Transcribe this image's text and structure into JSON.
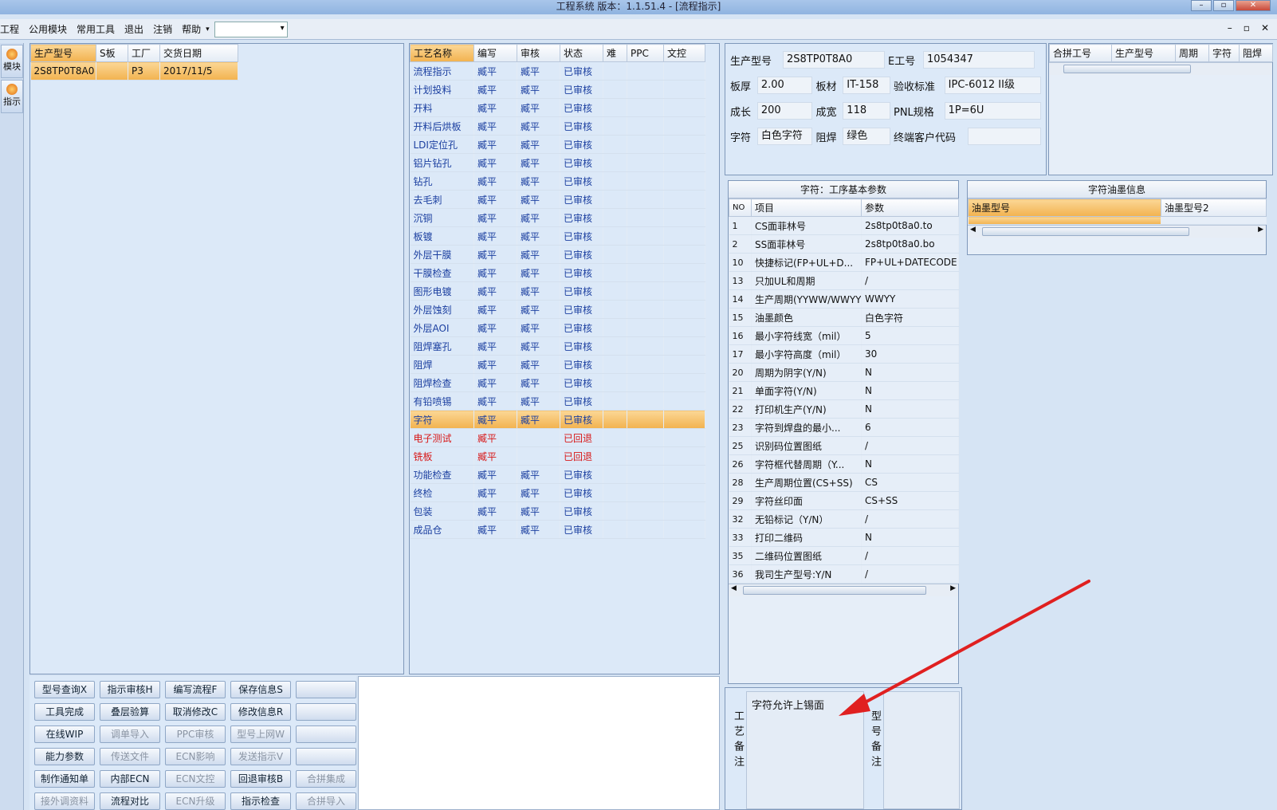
{
  "window": {
    "title": "工程系统   版本：1.1.51.4 - [流程指示]",
    "btn_min": "–",
    "btn_max": "▫",
    "btn_close": "✕"
  },
  "menu": {
    "items": [
      "工程",
      "公用模块",
      "常用工具",
      "退出",
      "注销",
      "帮助"
    ],
    "mdi": [
      "–",
      "▫",
      "✕"
    ]
  },
  "sidebar": {
    "items": [
      "模块",
      "指示"
    ]
  },
  "orders": {
    "headers": [
      "生产型号",
      "S板",
      "工厂",
      "交货日期"
    ],
    "rows": [
      [
        "2S8TP0T8A0",
        "",
        "P3",
        "2017/11/5"
      ]
    ]
  },
  "process": {
    "headers": [
      "工艺名称",
      "编写",
      "审核",
      "状态",
      "难",
      "PPC",
      "文控"
    ],
    "rows": [
      {
        "name": "流程指示",
        "writer": "臧平",
        "auditor": "臧平",
        "status": "已审核",
        "style": "blue"
      },
      {
        "name": "计划投料",
        "writer": "臧平",
        "auditor": "臧平",
        "status": "已审核",
        "style": "blue"
      },
      {
        "name": "开料",
        "writer": "臧平",
        "auditor": "臧平",
        "status": "已审核",
        "style": "blue"
      },
      {
        "name": "开料后烘板",
        "writer": "臧平",
        "auditor": "臧平",
        "status": "已审核",
        "style": "blue"
      },
      {
        "name": "LDI定位孔",
        "writer": "臧平",
        "auditor": "臧平",
        "status": "已审核",
        "style": "blue"
      },
      {
        "name": "铝片钻孔",
        "writer": "臧平",
        "auditor": "臧平",
        "status": "已审核",
        "style": "blue"
      },
      {
        "name": "钻孔",
        "writer": "臧平",
        "auditor": "臧平",
        "status": "已审核",
        "style": "blue"
      },
      {
        "name": "去毛刺",
        "writer": "臧平",
        "auditor": "臧平",
        "status": "已审核",
        "style": "blue"
      },
      {
        "name": "沉铜",
        "writer": "臧平",
        "auditor": "臧平",
        "status": "已审核",
        "style": "blue"
      },
      {
        "name": "板镀",
        "writer": "臧平",
        "auditor": "臧平",
        "status": "已审核",
        "style": "blue"
      },
      {
        "name": "外层干膜",
        "writer": "臧平",
        "auditor": "臧平",
        "status": "已审核",
        "style": "blue"
      },
      {
        "name": "干膜检查",
        "writer": "臧平",
        "auditor": "臧平",
        "status": "已审核",
        "style": "blue"
      },
      {
        "name": "图形电镀",
        "writer": "臧平",
        "auditor": "臧平",
        "status": "已审核",
        "style": "blue"
      },
      {
        "name": "外层蚀刻",
        "writer": "臧平",
        "auditor": "臧平",
        "status": "已审核",
        "style": "blue"
      },
      {
        "name": "外层AOI",
        "writer": "臧平",
        "auditor": "臧平",
        "status": "已审核",
        "style": "blue"
      },
      {
        "name": "阻焊塞孔",
        "writer": "臧平",
        "auditor": "臧平",
        "status": "已审核",
        "style": "blue"
      },
      {
        "name": "阻焊",
        "writer": "臧平",
        "auditor": "臧平",
        "status": "已审核",
        "style": "blue"
      },
      {
        "name": "阻焊检查",
        "writer": "臧平",
        "auditor": "臧平",
        "status": "已审核",
        "style": "blue"
      },
      {
        "name": "有铅喷锡",
        "writer": "臧平",
        "auditor": "臧平",
        "status": "已审核",
        "style": "blue"
      },
      {
        "name": "字符",
        "writer": "臧平",
        "auditor": "臧平",
        "status": "已审核",
        "style": "sel"
      },
      {
        "name": "电子测试",
        "writer": "臧平",
        "auditor": "",
        "status": "已回退",
        "style": "red"
      },
      {
        "name": "铣板",
        "writer": "臧平",
        "auditor": "",
        "status": "已回退",
        "style": "red"
      },
      {
        "name": "功能检查",
        "writer": "臧平",
        "auditor": "臧平",
        "status": "已审核",
        "style": "blue"
      },
      {
        "name": "终检",
        "writer": "臧平",
        "auditor": "臧平",
        "status": "已审核",
        "style": "blue"
      },
      {
        "name": "包装",
        "writer": "臧平",
        "auditor": "臧平",
        "status": "已审核",
        "style": "blue"
      },
      {
        "name": "成品仓",
        "writer": "臧平",
        "auditor": "臧平",
        "status": "已审核",
        "style": "blue"
      }
    ]
  },
  "buttons": [
    [
      "型号查询X",
      "指示审核H",
      "编写流程F",
      "保存信息S",
      ""
    ],
    [
      "工具完成",
      "叠层验算",
      "取消修改C",
      "修改信息R",
      ""
    ],
    [
      "在线WIP",
      "调单导入",
      "PPC审核",
      "型号上网W",
      ""
    ],
    [
      "能力参数",
      "传送文件",
      "ECN影响",
      "发送指示V",
      ""
    ],
    [
      "制作通知单",
      "内部ECN",
      "ECN文控",
      "回退审核B",
      "合拼集成"
    ],
    [
      "接外调资料",
      "流程对比",
      "ECN升级",
      "指示检查",
      "合拼导入"
    ]
  ],
  "buttons_disabled": [
    [
      false,
      false,
      false,
      false,
      false
    ],
    [
      false,
      false,
      false,
      false,
      false
    ],
    [
      false,
      true,
      true,
      true,
      false
    ],
    [
      false,
      true,
      true,
      true,
      false
    ],
    [
      false,
      false,
      true,
      false,
      true
    ],
    [
      true,
      false,
      true,
      false,
      true
    ]
  ],
  "info": {
    "fields": [
      [
        {
          "label": "生产型号",
          "value": "2S8TP0T8A0"
        },
        {
          "label": "E工号",
          "value": "1054347"
        }
      ],
      [
        {
          "label": "板厚",
          "value": "2.00"
        },
        {
          "label": "板材",
          "value": "IT-158"
        },
        {
          "label": "验收标准",
          "value": "IPC-6012 II级"
        }
      ],
      [
        {
          "label": "成长",
          "value": "200"
        },
        {
          "label": "成宽",
          "value": "118"
        },
        {
          "label": "PNL规格",
          "value": "1P=6U"
        }
      ],
      [
        {
          "label": "字符",
          "value": "白色字符"
        },
        {
          "label": "阻焊",
          "value": "绿色"
        },
        {
          "label": "终端客户代码",
          "value": ""
        }
      ]
    ]
  },
  "merge": {
    "headers": [
      "合拼工号",
      "生产型号",
      "周期",
      "字符",
      "阻焊"
    ]
  },
  "params": {
    "title": "字符：工序基本参数",
    "headers": [
      "NO",
      "项目",
      "参数"
    ],
    "rows": [
      [
        "1",
        "CS面菲林号",
        "2s8tp0t8a0.to"
      ],
      [
        "2",
        "SS面菲林号",
        "2s8tp0t8a0.bo"
      ],
      [
        "10",
        "快捷标记(FP+UL+D...",
        "FP+UL+DATECODE"
      ],
      [
        "13",
        "只加UL和周期",
        "/"
      ],
      [
        "14",
        "生产周期(YYWW/WWYY)",
        "WWYY"
      ],
      [
        "15",
        "油墨颜色",
        "白色字符"
      ],
      [
        "16",
        "最小字符线宽（mil）",
        "5"
      ],
      [
        "17",
        "最小字符高度（mil）",
        "30"
      ],
      [
        "20",
        "周期为阴字(Y/N)",
        "N"
      ],
      [
        "21",
        "单面字符(Y/N)",
        "N"
      ],
      [
        "22",
        "打印机生产(Y/N)",
        "N"
      ],
      [
        "23",
        "字符到焊盘的最小...",
        "6"
      ],
      [
        "25",
        "识别码位置图纸",
        "/"
      ],
      [
        "26",
        "字符框代替周期（Y...",
        "N"
      ],
      [
        "28",
        "生产周期位置(CS+SS)",
        "CS"
      ],
      [
        "29",
        "字符丝印面",
        "CS+SS"
      ],
      [
        "32",
        "无铅标记（Y/N）",
        "/"
      ],
      [
        "33",
        "打印二维码",
        "N"
      ],
      [
        "35",
        "二维码位置图纸",
        "/"
      ],
      [
        "36",
        "我司生产型号:Y/N",
        "/"
      ]
    ]
  },
  "ink": {
    "title": "字符油墨信息",
    "headers": [
      "油墨型号",
      "油墨型号2"
    ]
  },
  "remarks": {
    "process_label": "工艺备注",
    "process_text": "字符允许上锡面",
    "model_label": "型号备注",
    "model_text": ""
  },
  "colors": {
    "selection": "#f2b24f",
    "arrow": "#e02020",
    "link_blue": "#1b3fa0",
    "rollback_red": "#d81818"
  }
}
